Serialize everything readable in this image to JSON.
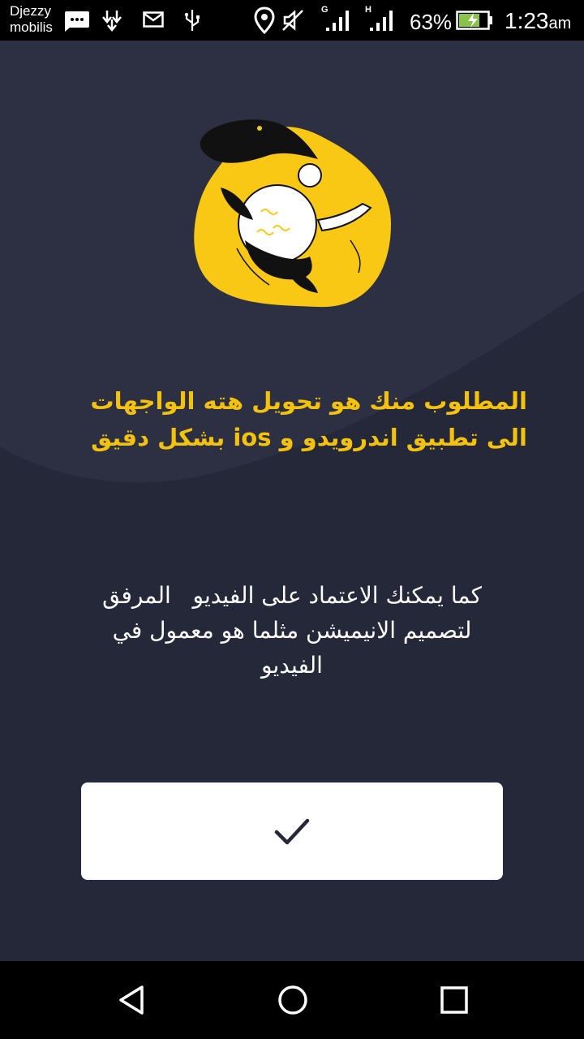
{
  "status_bar": {
    "carrier_line1": "Djezzy",
    "carrier_line2": "mobilis",
    "network_1": "G",
    "network_2": "H",
    "battery_percent": "63%",
    "time": "1:23",
    "time_suffix": "am",
    "icons": [
      "messages-icon",
      "download-icon",
      "mail-icon",
      "usb-icon",
      "location-icon",
      "mute-icon",
      "signal-icon",
      "signal-icon",
      "battery-charging-icon"
    ]
  },
  "onboarding": {
    "headline_line1": "المطلوب منك هو تحويل هته الواجهات",
    "headline_line2": "الى تطبيق اندرويدو و ios بشكل دقيق",
    "body": "كما يمكنك الاعتماد على الفيديو   المرفق\nلتصميم الانيميشن مثلما هو معمول في\nالفيديو",
    "confirm_icon": "checkmark-icon"
  },
  "nav_bar": {
    "icons": [
      "back-icon",
      "home-icon",
      "recents-icon"
    ]
  },
  "colors": {
    "background": "#252839",
    "background_top": "#2c3042",
    "accent": "#f4c20d",
    "button": "#ffffff",
    "bars": "#000000"
  }
}
